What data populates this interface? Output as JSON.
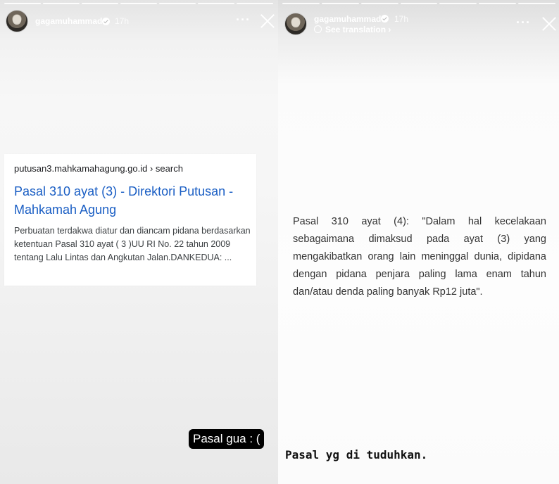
{
  "left_story": {
    "username": "gagamuhammad",
    "time": "17h",
    "more_label": "···",
    "search_result": {
      "url": "putusan3.mahkamahagung.go.id › search",
      "title": "Pasal 310 ayat (3) - Direktori Putusan - Mahkamah Agung",
      "snippet": "Perbuatan terdakwa diatur dan diancam pidana berdasarkan ketentuan Pasal 310 ayat ( 3 )UU RI No. 22 tahun 2009 tentang Lalu Lintas dan Angkutan Jalan.DANKEDUA: ..."
    },
    "caption": "Pasal gua : ("
  },
  "right_story": {
    "username": "gagamuhammad",
    "time": "17h",
    "see_translation": "See translation ›",
    "more_label": "···",
    "quote": "Pasal 310 ayat (4): \"Dalam hal kecelakaan sebagaimana dimaksud pada ayat (3) yang mengakibatkan orang lain meninggal dunia, dipidana dengan pidana penjara paling lama enam tahun dan/atau denda paling banyak Rp12 juta\".",
    "caption": "Pasal yg di tuduhkan."
  },
  "colors": {
    "link_blue": "#1a5ec4",
    "caption_bg": "#000000",
    "text_white": "#ffffff"
  },
  "icons": [
    "verified-icon",
    "more-icon",
    "close-icon",
    "globe-icon"
  ]
}
